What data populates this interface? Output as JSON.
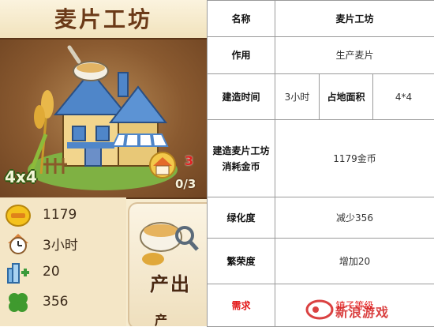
{
  "card": {
    "title": "麦片工坊",
    "size": "4x4",
    "limit_count": "3",
    "limit_fraction": "0/3",
    "stats": [
      {
        "icon": "gold-coin-icon",
        "value": "1179"
      },
      {
        "icon": "clock-icon",
        "value": "3小时"
      },
      {
        "icon": "prosperity-icon",
        "value": "20"
      },
      {
        "icon": "clover-icon",
        "value": "356"
      }
    ],
    "output": {
      "label": "产出",
      "label2": "产"
    }
  },
  "table": {
    "rows": [
      {
        "header": "名称",
        "value": "麦片工坊"
      },
      {
        "header": "作用",
        "value": "生产麦片"
      },
      {
        "header": "建造时间",
        "value": "3小时",
        "header2": "占地面积",
        "value2": "4*4"
      },
      {
        "header": "建造麦片工坊消耗金币",
        "value": "1179金币"
      },
      {
        "header": "绿化度",
        "value": "减少356"
      },
      {
        "header": "繁荣度",
        "value": "增加20"
      },
      {
        "header": "需求",
        "value": "镇子等级"
      }
    ]
  },
  "watermark": {
    "text": "新浪游戏"
  },
  "colors": {
    "title": "#6b3a18",
    "accent_red": "#e31b1b",
    "border": "#9a9a9a"
  }
}
